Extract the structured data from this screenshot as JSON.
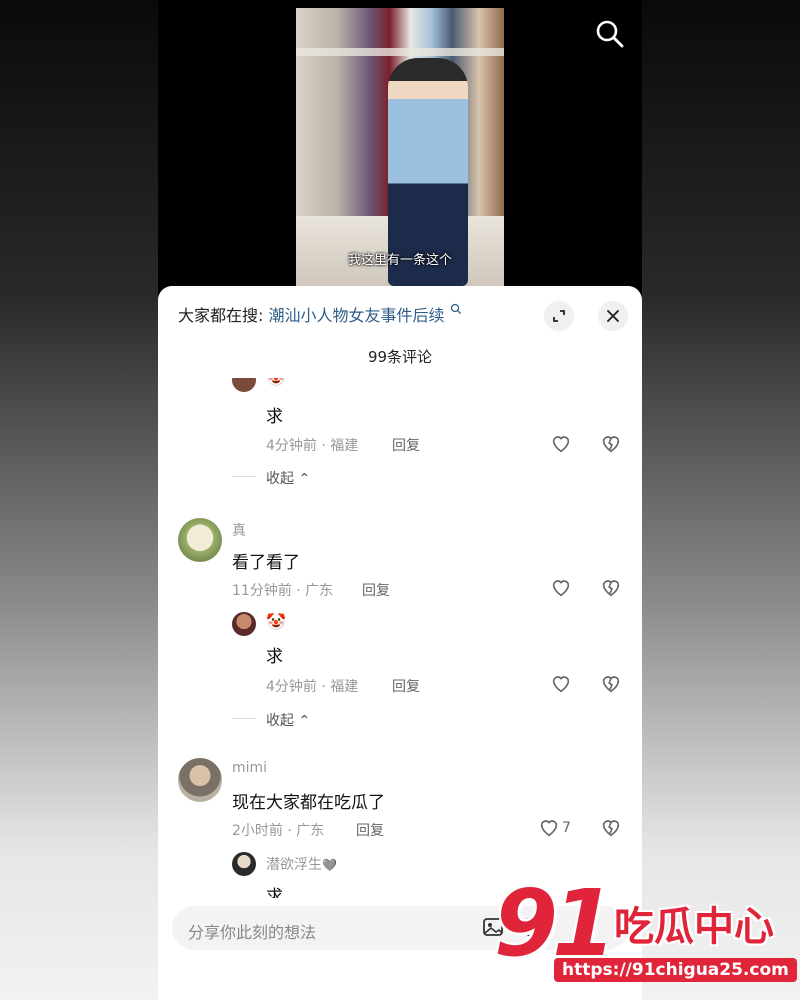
{
  "video": {
    "subtitle": "我这里有一条这个"
  },
  "sheet": {
    "search_prefix": "大家都在搜:",
    "search_keyword": "潮汕小人物女友事件后续",
    "comment_count": "99条评论"
  },
  "comments": {
    "reply_a": {
      "text": "求",
      "meta": "4分钟前 · 福建",
      "reply": "回复",
      "avatar_emoji": "🤡"
    },
    "collapse_a": "收起",
    "c1": {
      "user": "真",
      "text": "看了看了",
      "meta": "11分钟前 · 广东",
      "reply": "回复"
    },
    "reply_b": {
      "text": "求",
      "meta": "4分钟前 · 福建",
      "reply": "回复",
      "avatar_emoji": "🤡"
    },
    "collapse_b": "收起",
    "c2": {
      "user": "mimi",
      "text": "现在大家都在吃瓜了",
      "meta": "2小时前 · 广东",
      "reply": "回复",
      "likes": "7"
    },
    "reply_c": {
      "user": "潜欲浮生",
      "heart_emoji": "🩶",
      "text": "求"
    }
  },
  "input": {
    "placeholder": "分享你此刻的想法"
  },
  "watermark": {
    "number": "91",
    "title": "吃瓜中心",
    "url": "https://91chigua25.com"
  },
  "colors": {
    "keyword": "#2e5d8a",
    "watermark": "#e0243a"
  }
}
